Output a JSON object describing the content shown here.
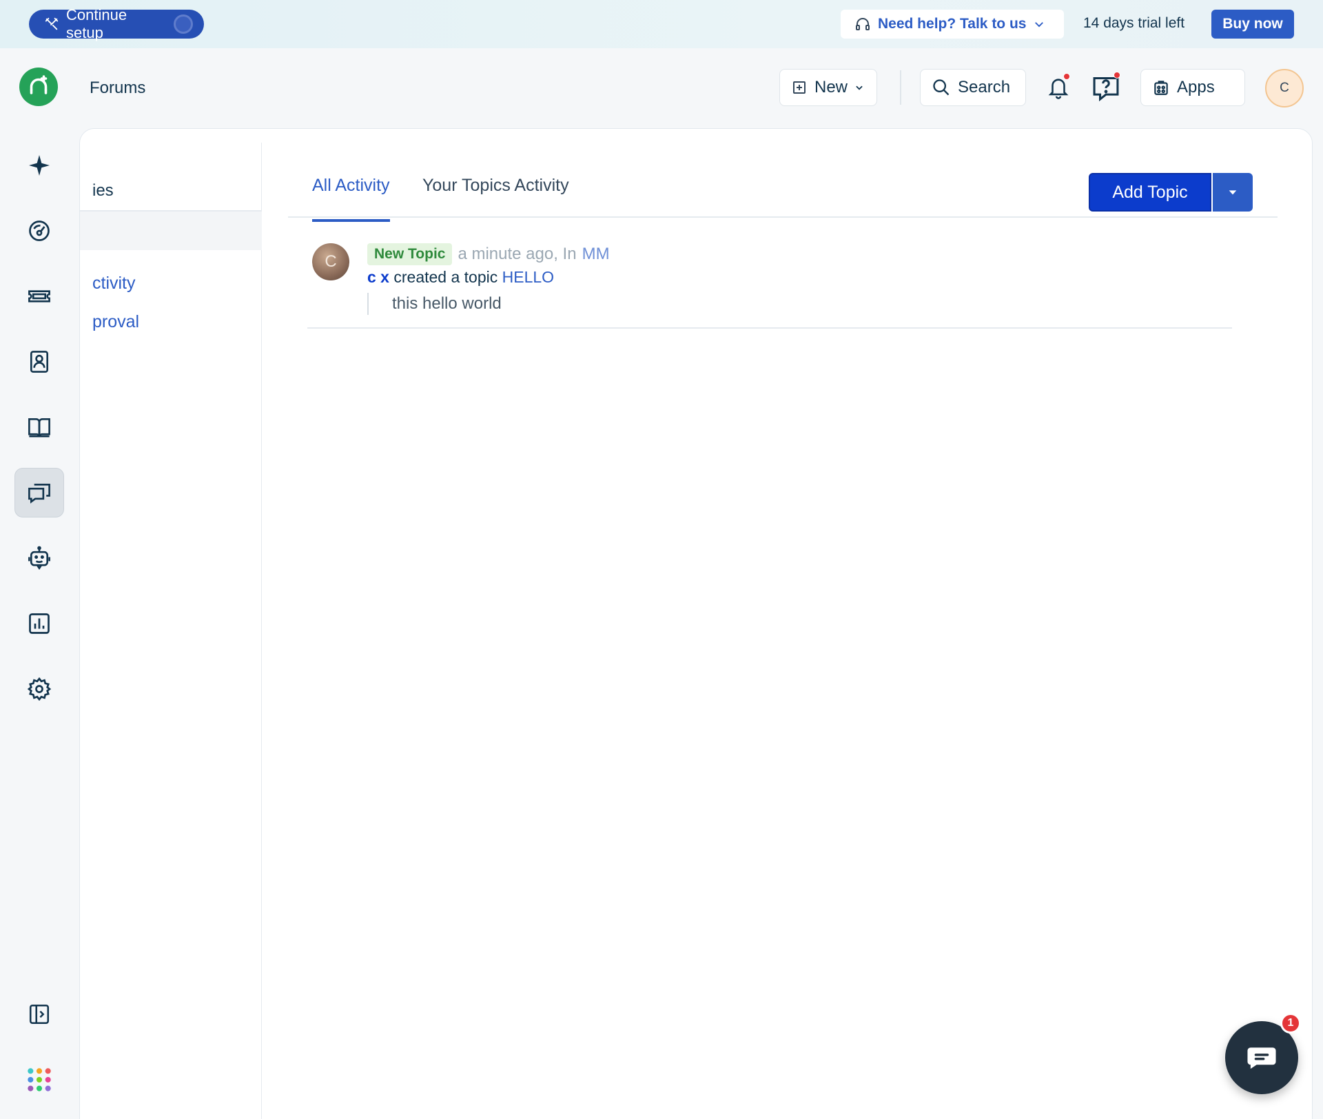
{
  "banner": {
    "setup_label": "Continue setup",
    "help_label": "Need help? Talk to us",
    "trial_text": "14 days trial left",
    "buy_label": "Buy now"
  },
  "header": {
    "title": "Forums",
    "new_label": "New",
    "search_label": "Search",
    "apps_label": "Apps",
    "avatar_initial": "C"
  },
  "subnav": {
    "title_fragment": "ies",
    "items": [
      {
        "label": "ctivity"
      },
      {
        "label": "proval"
      }
    ]
  },
  "tabs": [
    {
      "label": "All Activity",
      "active": true
    },
    {
      "label": "Your Topics Activity",
      "active": false
    }
  ],
  "actions": {
    "add_topic_label": "Add Topic"
  },
  "activity": [
    {
      "avatar_initial": "C",
      "badge": "New Topic",
      "time": "a minute ago, In",
      "forum": "MM",
      "author": "c x",
      "action_text": "created a topic",
      "topic": "HELLO",
      "excerpt": "this hello world"
    }
  ],
  "chat": {
    "unread": "1"
  },
  "colors": {
    "brand": "#2c5cc5",
    "primary_button": "#0c3ccc",
    "logo_green": "#25a258",
    "notification_red": "#e43538"
  }
}
